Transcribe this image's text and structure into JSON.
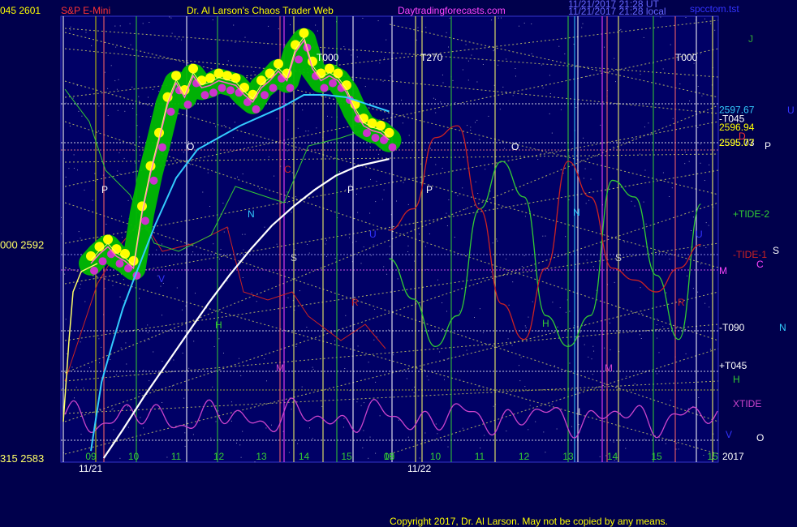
{
  "header": {
    "left_values": "045  2601",
    "instrument": "S&P E-Mini",
    "chart_title": "Dr. Al Larson's Chaos Trader Web",
    "site": "Daytradingforecasts.com",
    "stamp_line1": "11/21/2017 21:28 UT",
    "stamp_line2": "11/21/2017 21:28 local",
    "file_name": "spcctom.tst"
  },
  "copyright": "Copyright 2017, Dr. Al Larson. May not be copied by any means.",
  "colors": {
    "background": "#00004c",
    "plot_area": "#000066",
    "price_envelope": "#00bb00",
    "price_high_dots": "#ffff00",
    "price_low_dots": "#cc33cc",
    "moving_avg_fast": "#33ccff",
    "moving_avg_slow": "#ffffff",
    "tide1": "#cc2222",
    "tide2": "#33cc33",
    "xtide": "#cc44cc"
  },
  "chart_data": {
    "type": "line",
    "y_axis_left": {
      "ticks": [
        {
          "value": 2601,
          "label": "045  2601"
        },
        {
          "value": 2592,
          "label": "000  2592"
        },
        {
          "value": 2583,
          "label": "315  2583"
        }
      ],
      "range": [
        2583,
        2601
      ]
    },
    "x_axis": {
      "day_labels": [
        "11/21",
        "11/22"
      ],
      "hour_labels_day1": [
        "09",
        "10",
        "11",
        "12",
        "13",
        "14",
        "15",
        "16"
      ],
      "hour_labels_day2": [
        "09",
        "10",
        "11",
        "12",
        "13",
        "14",
        "15",
        "15"
      ],
      "year_label": "2017"
    },
    "right_price_labels": [
      {
        "value": 2597.67,
        "label": "2597.67",
        "color": "#33ccff"
      },
      {
        "value": 2597.3,
        "label": "-T045",
        "color": "#ffffff"
      },
      {
        "value": 2596.94,
        "label": "2596.94",
        "color": "#ffff00"
      },
      {
        "value": 2595.3,
        "label": "2595.73",
        "color": "#ffffff"
      },
      {
        "value": 2595.25,
        "label": "2595.07",
        "color": "#ffff00"
      },
      {
        "value": 2592.6,
        "label": "+TIDE-2",
        "color": "#33cc33"
      },
      {
        "value": 2591.2,
        "label": "-TIDE-1",
        "color": "#cc2222"
      },
      {
        "value": 2587.6,
        "label": "-T090",
        "color": "#ffffff"
      },
      {
        "value": 2585.6,
        "label": "+T045",
        "color": "#ffffff"
      },
      {
        "value": 2584.5,
        "label": "XTIDE",
        "color": "#cc44cc"
      }
    ],
    "planet_glyph_labels": [
      "J",
      "U",
      "P",
      "S",
      "C",
      "N",
      "O",
      "D",
      "H",
      "M",
      "V"
    ],
    "time_line_labels": [
      "T000",
      "T270",
      "T000"
    ],
    "vertical_line_letters": [
      "P",
      "O",
      "C",
      "N",
      "S",
      "H",
      "R",
      "P",
      "M",
      "U",
      "P",
      "O",
      "N",
      "S",
      "H",
      "R",
      "M",
      "U",
      "V",
      "I"
    ],
    "series": [
      {
        "name": "Price",
        "x": [
          0,
          0.2,
          0.4,
          0.6,
          0.8,
          1.0,
          1.2,
          1.4,
          1.6,
          1.8,
          2.0,
          2.2,
          2.4,
          2.6,
          2.8,
          3.0,
          3.2,
          3.4,
          3.6,
          3.8,
          4.0,
          4.2,
          4.4,
          4.6,
          4.8,
          5.0,
          5.2,
          5.4,
          5.6,
          5.8,
          6.0,
          6.2,
          6.4,
          6.6,
          6.8,
          7.0
        ],
        "values": [
          2591.2,
          2591.6,
          2591.9,
          2591.5,
          2591.3,
          2591.0,
          2593.3,
          2595.0,
          2596.4,
          2597.9,
          2598.8,
          2598.2,
          2599.1,
          2598.6,
          2598.7,
          2598.9,
          2598.8,
          2598.7,
          2598.3,
          2598.0,
          2598.6,
          2598.9,
          2599.3,
          2598.9,
          2600.1,
          2600.6,
          2599.4,
          2598.9,
          2599.1,
          2598.9,
          2598.4,
          2597.6,
          2597.0,
          2596.8,
          2596.7,
          2596.4
        ]
      },
      {
        "name": "",
        "x": [
          0,
          0.25,
          0.5,
          0.75,
          1.0,
          1.5,
          2.0,
          2.5,
          3.0,
          3.5,
          4.0,
          4.5,
          5.0,
          5.5,
          6.0,
          6.5,
          7.0
        ],
        "values": [
          2583.3,
          2586.2,
          2587.8,
          2589.3,
          2590.5,
          2592.8,
          2594.8,
          2596.0,
          2596.5,
          2597.0,
          2597.4,
          2597.8,
          2598.3,
          2598.3,
          2598.2,
          2597.9,
          2597.6
        ]
      },
      {
        "name": "",
        "x": [
          0.3,
          0.75,
          1.25,
          1.75,
          2.25,
          2.75,
          3.25,
          3.75,
          4.25,
          4.75,
          5.25,
          5.75,
          6.25,
          6.75,
          7.0
        ],
        "values": [
          2583.0,
          2584.2,
          2585.6,
          2586.9,
          2588.2,
          2589.5,
          2590.7,
          2591.8,
          2592.8,
          2593.6,
          2594.3,
          2594.9,
          2595.3,
          2595.5,
          2595.6
        ]
      }
    ],
    "tide_series": [
      {
        "name": "TIDE-2",
        "x": [
          7.0,
          7.5,
          8.0,
          8.5,
          9.0,
          9.5,
          10.0,
          10.5,
          11.0,
          11.5,
          12.0,
          12.5,
          13.0,
          13.5,
          14.0
        ],
        "values": [
          2591.4,
          2589.7,
          2587.7,
          2589.0,
          2593.5,
          2595.5,
          2594.0,
          2589.0,
          2587.7,
          2589.0,
          2594.7,
          2594.0,
          2590.7,
          2588.0,
          2593.7
        ]
      },
      {
        "name": "TIDE-1",
        "x": [
          7.0,
          7.5,
          8.0,
          8.5,
          9.0,
          9.5,
          10.0,
          10.5,
          11.0,
          11.5,
          12.0,
          12.5,
          13.0,
          13.5,
          14.0
        ],
        "values": [
          2592.6,
          2593.5,
          2596.5,
          2597.0,
          2593.5,
          2589.5,
          2588.0,
          2591.0,
          2595.5,
          2594.0,
          2591.0,
          2590.5,
          2590.0,
          2591.0,
          2592.0
        ]
      }
    ],
    "grid": false,
    "legend": "right"
  }
}
